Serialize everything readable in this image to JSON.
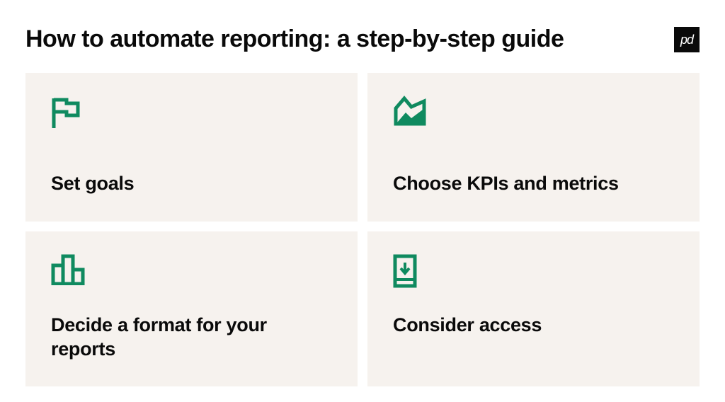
{
  "header": {
    "title": "How to automate reporting: a step-by-step guide",
    "logo_text": "pd"
  },
  "cards": [
    {
      "title": "Set goals"
    },
    {
      "title": "Choose KPIs and metrics"
    },
    {
      "title": "Decide a format for your reports"
    },
    {
      "title": "Consider access"
    }
  ],
  "colors": {
    "accent": "#0f8a5f",
    "card_bg": "#f6f2ee",
    "text": "#0a0a0a"
  }
}
